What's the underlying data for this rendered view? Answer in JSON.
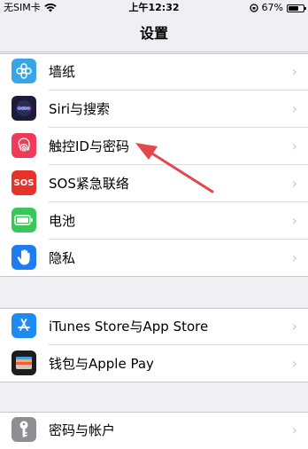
{
  "status": {
    "carrier": "无SIM卡",
    "time": "上午12:32",
    "battery": "67%",
    "battery_level": 0.67
  },
  "nav": {
    "title": "设置"
  },
  "groups": [
    {
      "rows": [
        {
          "label": "墙纸",
          "icon": "wallpaper-icon",
          "color": "#36a6e6"
        },
        {
          "label": "Siri与搜索",
          "icon": "siri-icon",
          "color": "#1c1c3a"
        },
        {
          "label": "触控ID与密码",
          "icon": "fingerprint-icon",
          "color": "#ee3b5a"
        },
        {
          "label": "SOS紧急联络",
          "icon": "sos-icon",
          "color": "#e5332a",
          "icon_text": "SOS"
        },
        {
          "label": "电池",
          "icon": "battery-icon",
          "color": "#38c85a"
        },
        {
          "label": "隐私",
          "icon": "hand-icon",
          "color": "#1f7cf0"
        }
      ]
    },
    {
      "rows": [
        {
          "label": "iTunes Store与App Store",
          "icon": "app-store-icon",
          "color": "#1e8bf3"
        },
        {
          "label": "钱包与Apple Pay",
          "icon": "wallet-icon",
          "color": "#1d1d1d"
        }
      ]
    },
    {
      "rows": [
        {
          "label": "密码与帐户",
          "icon": "key-icon",
          "color": "#8e8e93"
        }
      ]
    }
  ],
  "chevron": "›",
  "colors": {
    "annotation_arrow": "#e2474b"
  }
}
